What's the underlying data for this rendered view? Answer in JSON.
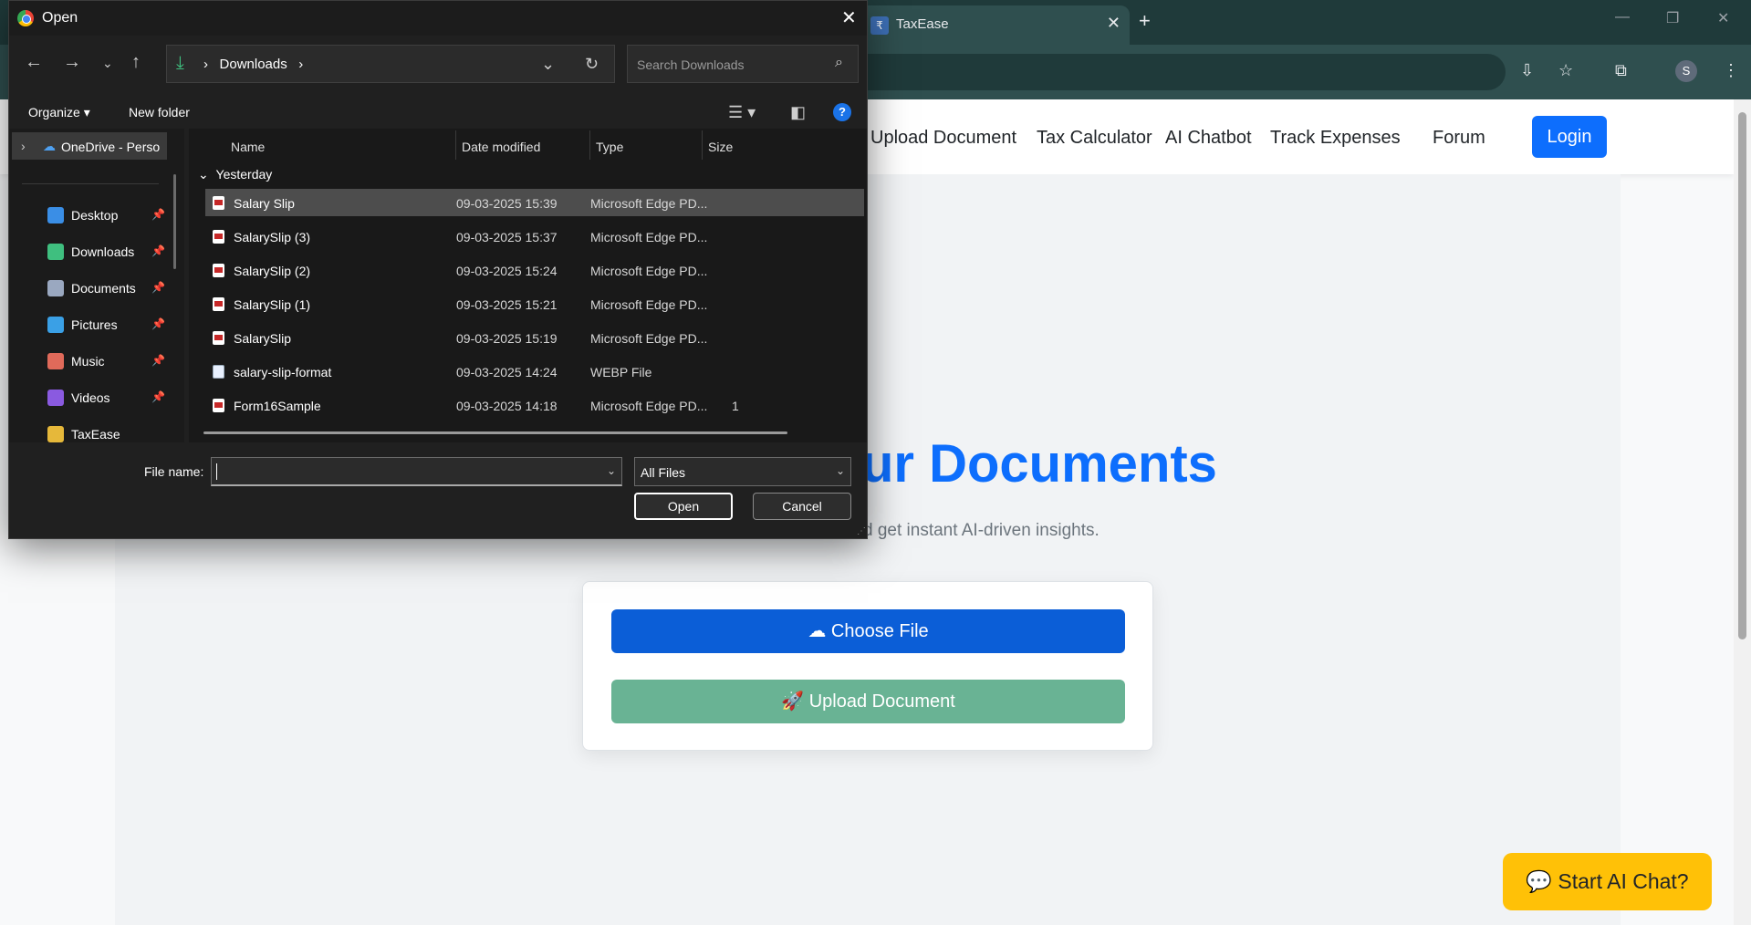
{
  "browser": {
    "tab_title": "TaxEase",
    "tab_close": "✕",
    "new_tab": "+",
    "profile_initial": "S"
  },
  "page": {
    "nav": [
      "Upload Document",
      "Tax Calculator",
      "AI Chatbot",
      "Track Expenses",
      "Forum"
    ],
    "login": "Login",
    "hero_title": "ur Documents",
    "hero_sub": "d get instant AI-driven insights.",
    "choose_file": "Choose File",
    "upload_document": "Upload Document",
    "start_chat": "Start AI Chat?"
  },
  "dialog": {
    "title": "Open",
    "address": {
      "path": "Downloads",
      "sep1": "›",
      "sep2": "›"
    },
    "search_placeholder": "Search Downloads",
    "organize": "Organize ▾",
    "new_folder": "New folder",
    "help": "?",
    "nav_pane": {
      "onedrive": "OneDrive - Perso",
      "items": [
        {
          "label": "Desktop",
          "color": "#3a8ee6"
        },
        {
          "label": "Downloads",
          "color": "#3fbf7f"
        },
        {
          "label": "Documents",
          "color": "#9aa8c0"
        },
        {
          "label": "Pictures",
          "color": "#3aa0e6"
        },
        {
          "label": "Music",
          "color": "#e06a5a"
        },
        {
          "label": "Videos",
          "color": "#8a5ae0"
        },
        {
          "label": "TaxEase",
          "color": "#e6b83a"
        }
      ]
    },
    "columns": {
      "name": "Name",
      "date": "Date modified",
      "type": "Type",
      "size": "Size"
    },
    "group": "Yesterday",
    "files": [
      {
        "name": "Salary Slip",
        "date": "09-03-2025 15:39",
        "type": "Microsoft Edge PD...",
        "size": "",
        "icon": "pdf"
      },
      {
        "name": "SalarySlip (3)",
        "date": "09-03-2025 15:37",
        "type": "Microsoft Edge PD...",
        "size": "",
        "icon": "pdf"
      },
      {
        "name": "SalarySlip (2)",
        "date": "09-03-2025 15:24",
        "type": "Microsoft Edge PD...",
        "size": "",
        "icon": "pdf"
      },
      {
        "name": "SalarySlip (1)",
        "date": "09-03-2025 15:21",
        "type": "Microsoft Edge PD...",
        "size": "",
        "icon": "pdf"
      },
      {
        "name": "SalarySlip",
        "date": "09-03-2025 15:19",
        "type": "Microsoft Edge PD...",
        "size": "",
        "icon": "pdf"
      },
      {
        "name": "salary-slip-format",
        "date": "09-03-2025 14:24",
        "type": "WEBP File",
        "size": "",
        "icon": "webp"
      },
      {
        "name": "Form16Sample",
        "date": "09-03-2025 14:18",
        "type": "Microsoft Edge PD...",
        "size": "1",
        "icon": "pdf"
      }
    ],
    "file_name_label": "File name:",
    "file_name_value": "",
    "file_type": "All Files",
    "open": "Open",
    "cancel": "Cancel"
  }
}
